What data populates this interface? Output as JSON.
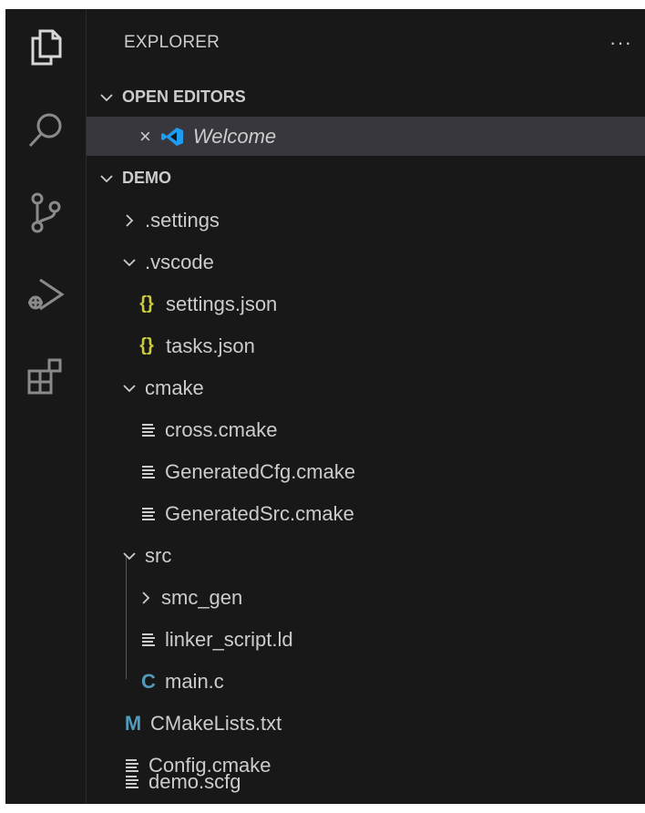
{
  "explorer": {
    "title": "EXPLORER",
    "more_label": "···"
  },
  "open_editors": {
    "label": "OPEN EDITORS",
    "items": [
      {
        "close_label": "×",
        "label": "Welcome",
        "icon": "vscode-logo-icon"
      }
    ]
  },
  "workspace": {
    "label": "DEMO",
    "tree": [
      {
        "label": ".settings",
        "type": "folder",
        "expanded": false
      },
      {
        "label": ".vscode",
        "type": "folder",
        "expanded": true
      },
      {
        "label": "settings.json",
        "type": "file",
        "icon": "json-icon",
        "icon_glyph": "{}"
      },
      {
        "label": "tasks.json",
        "type": "file",
        "icon": "json-icon",
        "icon_glyph": "{}"
      },
      {
        "label": "cmake",
        "type": "folder",
        "expanded": true
      },
      {
        "label": "cross.cmake",
        "type": "file",
        "icon": "text-lines-icon"
      },
      {
        "label": "GeneratedCfg.cmake",
        "type": "file",
        "icon": "text-lines-icon"
      },
      {
        "label": "GeneratedSrc.cmake",
        "type": "file",
        "icon": "text-lines-icon"
      },
      {
        "label": "src",
        "type": "folder",
        "expanded": true
      },
      {
        "label": "smc_gen",
        "type": "folder",
        "expanded": false
      },
      {
        "label": "linker_script.ld",
        "type": "file",
        "icon": "text-lines-icon"
      },
      {
        "label": "main.c",
        "type": "file",
        "icon": "c-file-icon",
        "icon_glyph": "C"
      },
      {
        "label": "CMakeLists.txt",
        "type": "file",
        "icon": "cmake-m-icon",
        "icon_glyph": "M"
      },
      {
        "label": "Config.cmake",
        "type": "file",
        "icon": "text-lines-icon"
      },
      {
        "label": "demo.scfg",
        "type": "file",
        "icon": "text-lines-icon"
      }
    ]
  },
  "colors": {
    "background": "#181818",
    "selected_row": "#37373d",
    "text": "#cccccc",
    "json_icon": "#cbcb41",
    "c_icon": "#519aba",
    "vscode_blue": "#1f9cf0"
  }
}
